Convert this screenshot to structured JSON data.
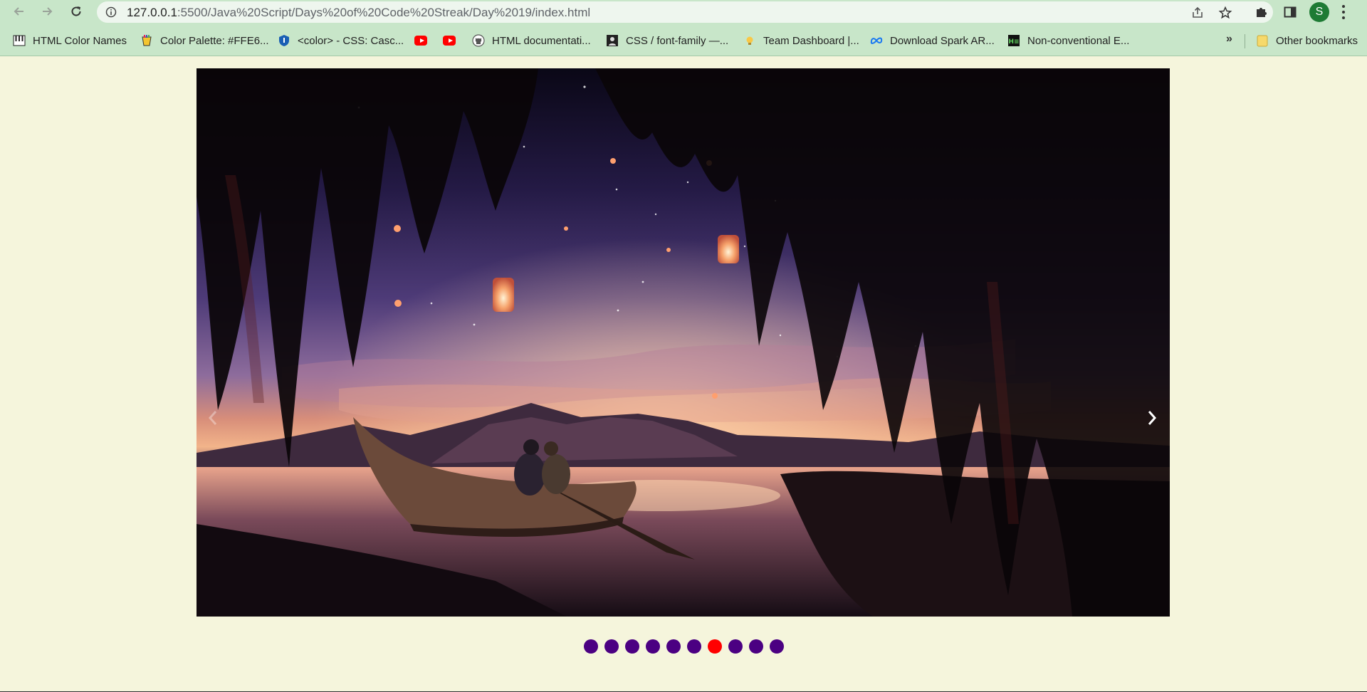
{
  "browser": {
    "url_host": "127.0.0.1",
    "url_rest": ":5500/Java%20Script/Days%20of%20Code%20Streak/Day%2019/index.html",
    "avatar_letter": "S",
    "toolbar_color": "#c8e6c9",
    "avatar_color": "#1e7b34"
  },
  "bookmarks": {
    "items": [
      {
        "label": "HTML Color Names",
        "icon": "piano-keys-icon"
      },
      {
        "label": "Color Palette: #FFE6...",
        "icon": "palette-cup-icon"
      },
      {
        "label": "<color> - CSS: Casc...",
        "icon": "mdn-shield-icon"
      },
      {
        "label": "",
        "icon": "youtube-icon"
      },
      {
        "label": "",
        "icon": "youtube-icon"
      },
      {
        "label": "HTML documentati...",
        "icon": "github-icon"
      },
      {
        "label": "CSS / font-family —...",
        "icon": "avatar-square-icon"
      },
      {
        "label": "Team Dashboard |...",
        "icon": "bulb-icon"
      },
      {
        "label": "Download Spark AR...",
        "icon": "meta-icon"
      },
      {
        "label": "Non-conventional E...",
        "icon": "hackerearth-icon"
      }
    ],
    "other_label": "Other bookmarks"
  },
  "slideshow": {
    "total_slides": 10,
    "active_index": 6,
    "dot_color": "#4b0082",
    "active_dot_color": "#ff0000"
  },
  "page": {
    "background": "#f5f5dc"
  }
}
